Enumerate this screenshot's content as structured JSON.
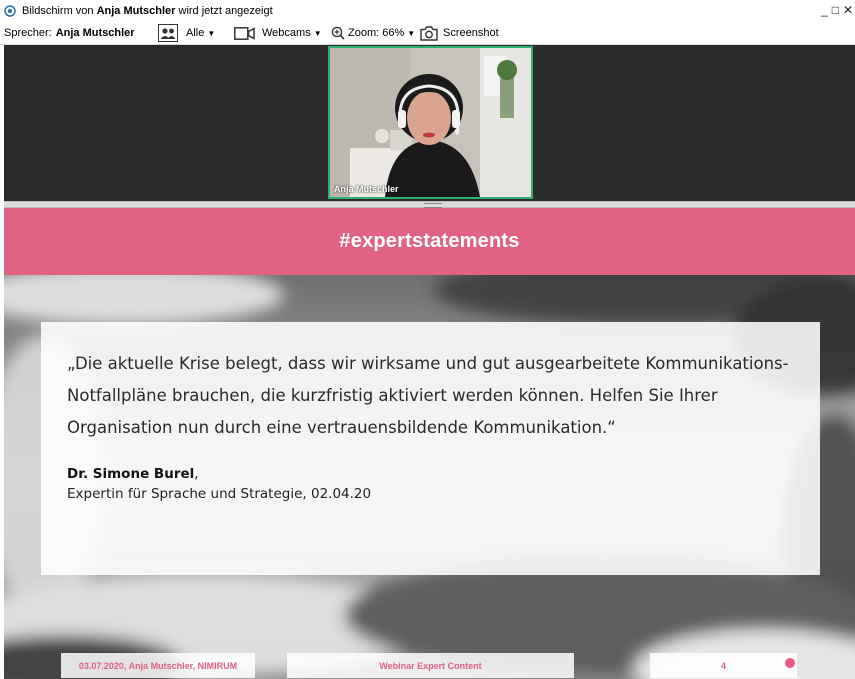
{
  "window": {
    "title_prefix": "Bildschirm von ",
    "title_name": "Anja Mutschler",
    "title_suffix": " wird jetzt angezeigt",
    "controls": [
      "_",
      "□",
      "✕"
    ]
  },
  "toolbar": {
    "speaker_label": "Sprecher:",
    "speaker_name": "Anja Mutschler",
    "view_label": "Alle",
    "webcams_label": "Webcams",
    "zoom_label": "Zoom: 66%",
    "screenshot_label": "Screenshot"
  },
  "webcam": {
    "participant_name": "Anja Mutschler",
    "border_color": "#2fb073"
  },
  "slide": {
    "header": "#expertstatements",
    "header_color": "#e06384",
    "quote": "„Die aktuelle Krise belegt, dass wir wirksame und gut ausgearbeitete Kommunikations-Notfallpläne brauchen, die kurzfristig aktiviert werden können. Helfen Sie Ihrer Organisation nun durch eine vertrauensbildende Kommunikation.“",
    "author_name": "Dr. Simone Burel",
    "author_comma": ",",
    "author_role": "Expertin für Sprache und Strategie, 02.04.20",
    "footer_left": "03.07.2020, Anja Mutschler, NIMIRUM",
    "footer_center": "Webinar Expert Content",
    "footer_page": "4"
  }
}
